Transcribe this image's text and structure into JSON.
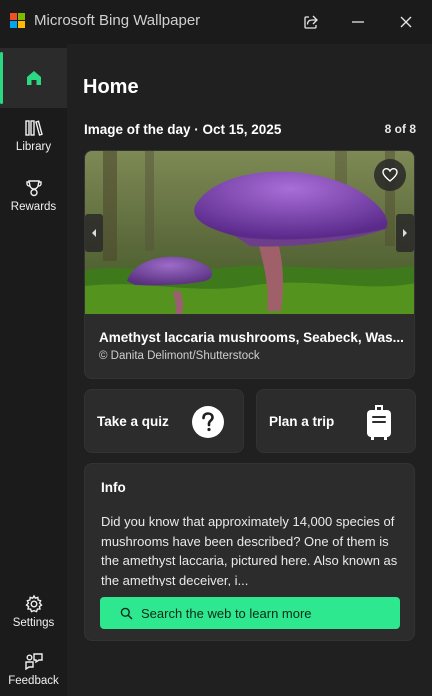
{
  "window": {
    "title": "Microsoft Bing Wallpaper",
    "logo_colors": [
      "#f25022",
      "#7fba00",
      "#00a4ef",
      "#ffb900"
    ]
  },
  "sidebar": {
    "items": [
      {
        "name": "home",
        "label": "",
        "icon": "home-icon",
        "active": true
      },
      {
        "name": "library",
        "label": "Library",
        "icon": "library-icon",
        "active": false
      },
      {
        "name": "rewards",
        "label": "Rewards",
        "icon": "trophy-icon",
        "active": false
      }
    ],
    "bottom_items": [
      {
        "name": "settings",
        "label": "Settings",
        "icon": "gear-icon"
      },
      {
        "name": "feedback",
        "label": "Feedback",
        "icon": "feedback-icon"
      }
    ]
  },
  "main": {
    "title": "Home",
    "image_of_the_day_label": "Image of the day · Oct 15, 2025",
    "page_count": "8 of 8",
    "image": {
      "title": "Amethyst laccaria mushrooms, Seabeck, Was...",
      "credit": "© Danita Delimont/Shutterstock"
    },
    "actions": [
      {
        "label": "Take a quiz",
        "icon": "question-icon"
      },
      {
        "label": "Plan a trip",
        "icon": "luggage-icon"
      }
    ],
    "info": {
      "title": "Info",
      "body": "Did you know that approximately 14,000 species of mushrooms have been described? One of them is the amethyst laccaria, pictured here. Also known as the amethyst deceiver, i...",
      "search_button": "Search the web to learn more"
    }
  },
  "colors": {
    "accent": "#2ee88f",
    "background": "#202020"
  }
}
